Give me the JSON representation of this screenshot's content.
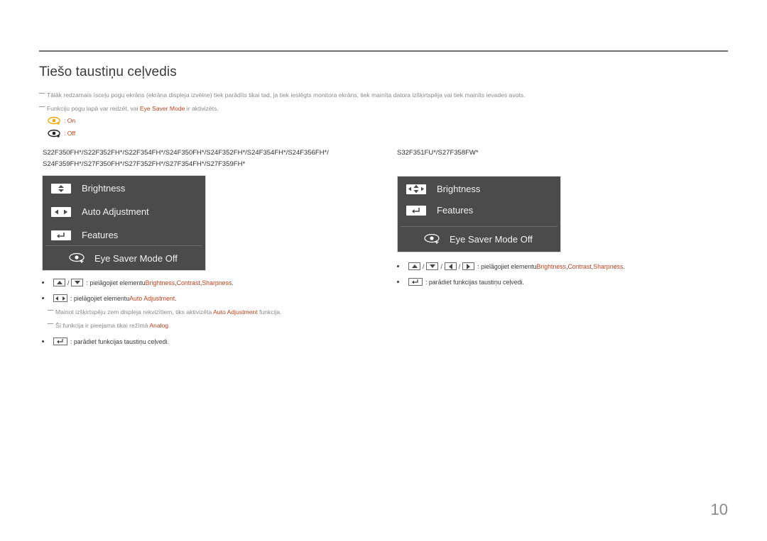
{
  "page": {
    "title": "Tiešo taustiņu ceļvedis",
    "page_number": "10"
  },
  "notes": [
    {
      "text": "Tālāk redzamais īsceļu pogu ekrāns (ekrāna displeja izvēlne) tiek parādīts tikai tad, ja tiek ieslēgts monitora ekrāns, tiek mainīta datora izšķirtspēja vai tiek mainīts ievades avots."
    },
    {
      "before": "Funkciju pogu lapā var redzēt, vai ",
      "highlight": "Eye Saver Mode",
      "after": " ir aktivizēts."
    }
  ],
  "eye_saver_legend": {
    "on": {
      "label": ": On",
      "icon": "eye-saver-on-icon",
      "color": "#f0a800"
    },
    "off": {
      "label": ": Off",
      "icon": "eye-saver-off-icon",
      "color": "#1a1a1a"
    }
  },
  "left": {
    "models_line1": "S22F350FH*/S22F352FH*/S22F354FH*/S24F350FH*/S24F352FH*/S24F354FH*/S24F356FH*/",
    "models_line2": "S24F359FH*/S27F350FH*/S27F352FH*/S27F354FH*/S27F359FH*",
    "osd": {
      "items": [
        {
          "icon": "up-down-key-icon",
          "label": "Brightness"
        },
        {
          "icon": "left-right-key-icon",
          "label": "Auto Adjustment"
        },
        {
          "icon": "enter-key-icon",
          "label": "Features"
        }
      ],
      "eye_saver_label": "Eye Saver Mode Off"
    },
    "bullets": [
      {
        "keys": [
          "up",
          "down"
        ],
        "text": ": pielāgojiet elementu ",
        "highlights": [
          "Brightness",
          "Contrast",
          "Sharpness"
        ]
      },
      {
        "keys": [
          "left-right"
        ],
        "text": ": pielāgojiet elementu ",
        "highlights": [
          "Auto Adjustment"
        ]
      },
      {
        "keys": [
          "enter"
        ],
        "text": ": parādiet funkcijas taustiņu ceļvedi."
      }
    ],
    "subnotes": [
      {
        "before": "Mainot izšķirtspēju zem displeja rekvizītiem, tiks aktivizēta ",
        "highlight": "Auto Adjustment",
        "after": " funkcija."
      },
      {
        "before": "Šī funkcija ir pieejama tikai režīmā ",
        "highlight": "Analog",
        "after": "."
      }
    ]
  },
  "right": {
    "models_line1": "S32F351FU*/S27F358FW*",
    "osd": {
      "items": [
        {
          "icon": "four-way-key-icon",
          "label": "Brightness"
        },
        {
          "icon": "enter-key-icon",
          "label": "Features"
        }
      ],
      "eye_saver_label": "Eye Saver Mode Off"
    },
    "bullets": [
      {
        "keys": [
          "up",
          "down",
          "left",
          "right"
        ],
        "text": ": pielāgojiet elementu ",
        "highlights": [
          "Brightness",
          "Contrast",
          "Sharpness"
        ]
      },
      {
        "keys": [
          "enter"
        ],
        "text": ": parādiet funkcijas taustiņu ceļvedi."
      }
    ]
  },
  "punct": {
    "comma": ", ",
    "period": ".",
    "slash": "/"
  }
}
